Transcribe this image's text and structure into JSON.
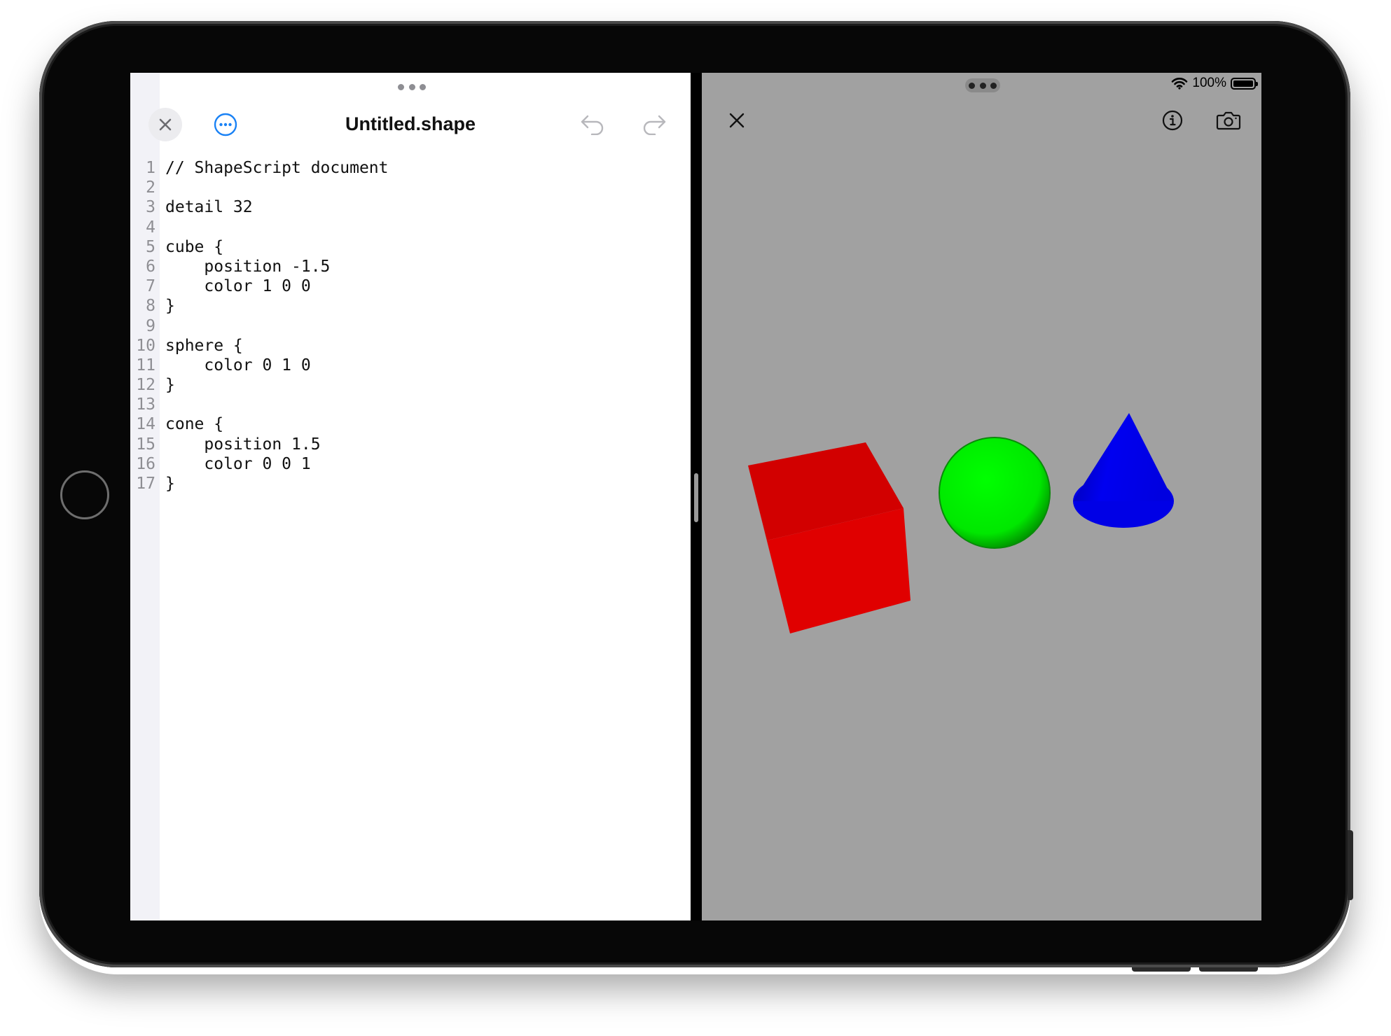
{
  "editor": {
    "title": "Untitled.shape",
    "code_lines": [
      {
        "num": "1",
        "text": "// ShapeScript document"
      },
      {
        "num": "2",
        "text": ""
      },
      {
        "num": "3",
        "text": "detail 32"
      },
      {
        "num": "4",
        "text": ""
      },
      {
        "num": "5",
        "text": "cube {"
      },
      {
        "num": "6",
        "text": "    position -1.5"
      },
      {
        "num": "7",
        "text": "    color 1 0 0"
      },
      {
        "num": "8",
        "text": "}"
      },
      {
        "num": "9",
        "text": ""
      },
      {
        "num": "10",
        "text": "sphere {"
      },
      {
        "num": "11",
        "text": "    color 0 1 0"
      },
      {
        "num": "12",
        "text": "}"
      },
      {
        "num": "13",
        "text": ""
      },
      {
        "num": "14",
        "text": "cone {"
      },
      {
        "num": "15",
        "text": "    position 1.5"
      },
      {
        "num": "16",
        "text": "    color 0 0 1"
      },
      {
        "num": "17",
        "text": "}"
      }
    ],
    "icons": {
      "close": "close-icon",
      "more": "ellipsis-circle-icon",
      "undo": "undo-arrow-icon",
      "redo": "redo-arrow-icon"
    },
    "accent_color": "#1a82f5"
  },
  "preview": {
    "status": {
      "battery_text": "100%",
      "wifi_icon": "wifi-icon",
      "battery_icon": "battery-icon"
    },
    "icons": {
      "dismiss": "close-icon",
      "info": "info-circle-icon",
      "camera": "camera-icon"
    },
    "background_color": "#a1a1a1",
    "shapes": [
      {
        "name": "cube",
        "color": "#e00000"
      },
      {
        "name": "sphere",
        "color": "#00e000"
      },
      {
        "name": "cone",
        "color": "#0000f0"
      }
    ]
  }
}
